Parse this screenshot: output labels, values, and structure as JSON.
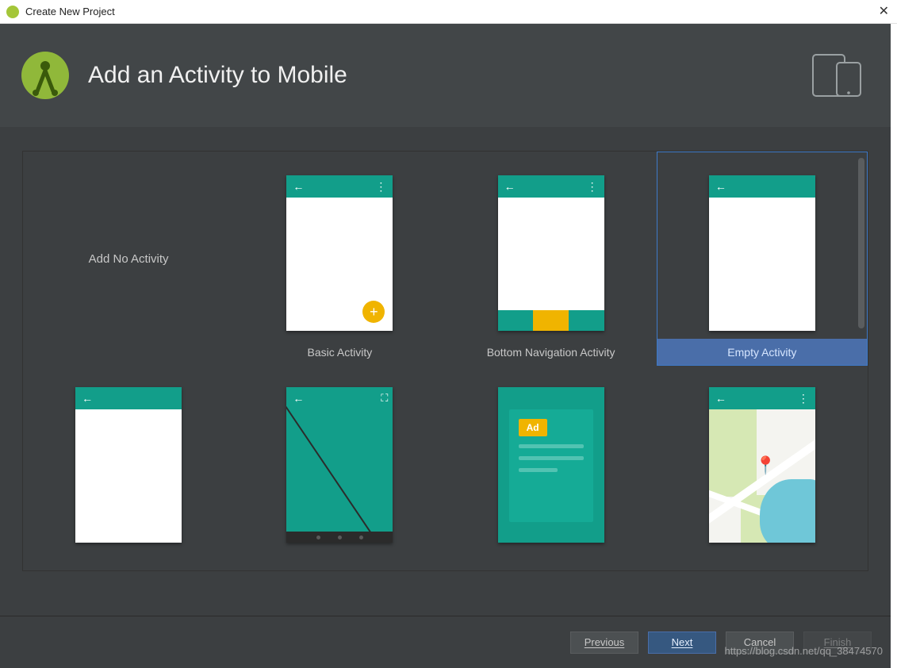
{
  "window": {
    "title": "Create New Project"
  },
  "header": {
    "title": "Add an Activity to Mobile"
  },
  "templates": {
    "add_no_activity": "Add No Activity",
    "basic_activity": "Basic Activity",
    "bottom_navigation_activity": "Bottom Navigation Activity",
    "empty_activity": "Empty Activity",
    "ad_label": "Ad"
  },
  "footer": {
    "previous": "Previous",
    "next": "Next",
    "cancel": "Cancel",
    "finish": "Finish"
  },
  "watermark": "https://blog.csdn.net/qq_38474570"
}
